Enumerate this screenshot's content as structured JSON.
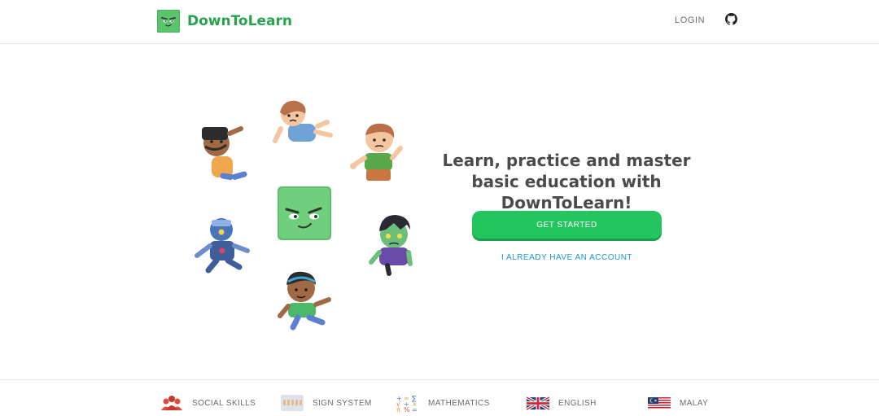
{
  "header": {
    "brand_name": "DownToLearn",
    "login_label": "LOGIN",
    "github_icon": "github-icon"
  },
  "hero": {
    "headline": "Learn, practice and master basic education with DownToLearn!",
    "primary_cta": "GET STARTED",
    "secondary_cta": "I ALREADY HAVE AN ACCOUNT"
  },
  "footer": {
    "items": [
      {
        "label": "SOCIAL SKILLS",
        "icon": "people-icon"
      },
      {
        "label": "SIGN SYSTEM",
        "icon": "sign-hands-icon"
      },
      {
        "label": "MATHEMATICS",
        "icon": "math-symbols-icon"
      },
      {
        "label": "ENGLISH",
        "icon": "uk-flag-icon"
      },
      {
        "label": "MALAY",
        "icon": "malaysia-flag-icon"
      }
    ]
  },
  "colors": {
    "brand_green": "#27a24d",
    "button_green": "#22c55e",
    "link_blue": "#1899d6",
    "text_dark": "#4b4b4b",
    "text_muted": "#6b6b6b"
  }
}
